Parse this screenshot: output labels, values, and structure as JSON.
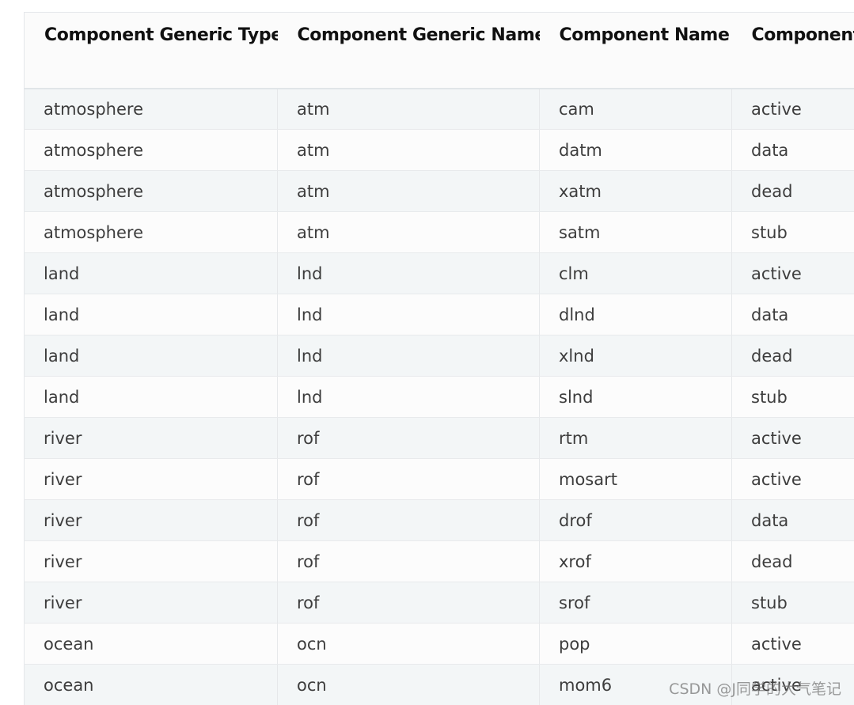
{
  "table": {
    "columns": [
      "Component Generic Type",
      "Component Generic Name",
      "Component Name",
      "Component"
    ],
    "rows": [
      [
        "atmosphere",
        "atm",
        "cam",
        "active"
      ],
      [
        "atmosphere",
        "atm",
        "datm",
        "data"
      ],
      [
        "atmosphere",
        "atm",
        "xatm",
        "dead"
      ],
      [
        "atmosphere",
        "atm",
        "satm",
        "stub"
      ],
      [
        "land",
        "lnd",
        "clm",
        "active"
      ],
      [
        "land",
        "lnd",
        "dlnd",
        "data"
      ],
      [
        "land",
        "lnd",
        "xlnd",
        "dead"
      ],
      [
        "land",
        "lnd",
        "slnd",
        "stub"
      ],
      [
        "river",
        "rof",
        "rtm",
        "active"
      ],
      [
        "river",
        "rof",
        "mosart",
        "active"
      ],
      [
        "river",
        "rof",
        "drof",
        "data"
      ],
      [
        "river",
        "rof",
        "xrof",
        "dead"
      ],
      [
        "river",
        "rof",
        "srof",
        "stub"
      ],
      [
        "ocean",
        "ocn",
        "pop",
        "active"
      ],
      [
        "ocean",
        "ocn",
        "mom6",
        "active"
      ]
    ]
  },
  "watermark": "CSDN @J同学的大气笔记"
}
